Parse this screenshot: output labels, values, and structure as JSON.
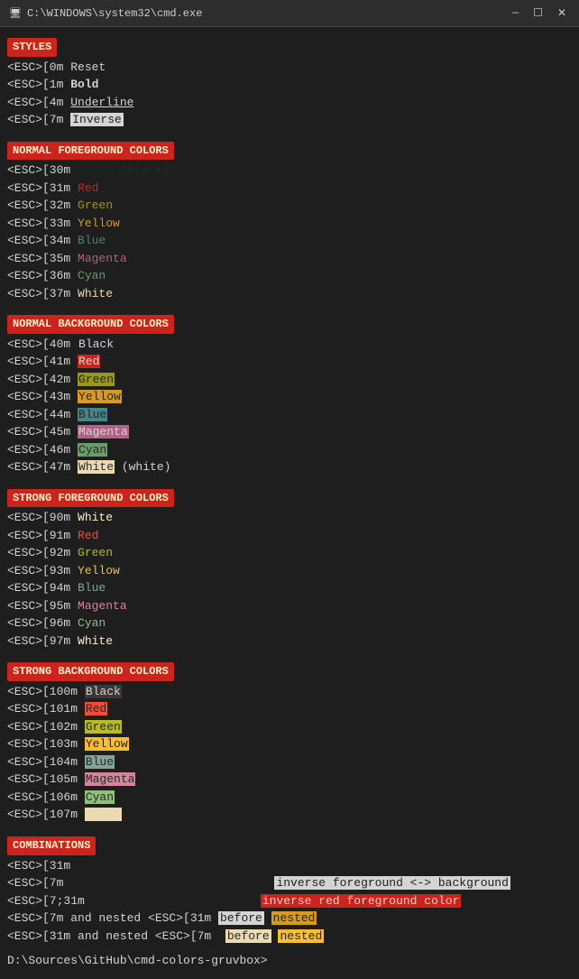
{
  "titlebar": {
    "icon": "cmd-icon",
    "title": "C:\\WINDOWS\\system32\\cmd.exe",
    "minimize": "—",
    "maximize": "☐",
    "close": "✕"
  },
  "sections": {
    "styles": "STYLES",
    "normal_fg": "NORMAL FOREGROUND COLORS",
    "normal_bg": "NORMAL BACKGROUND COLORS",
    "strong_fg": "STRONG FOREGROUND COLORS",
    "strong_bg": "STRONG BACKGROUND COLORS",
    "combos": "COMBINATIONS"
  },
  "prompt": "D:\\Sources\\GitHub\\cmd-colors-gruvbox>"
}
